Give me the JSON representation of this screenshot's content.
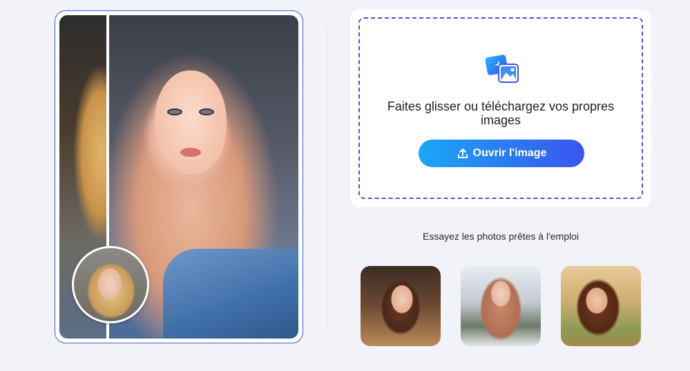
{
  "preview": {
    "description_icon": "before-after-comparison"
  },
  "upload": {
    "icon": "image-add-icon",
    "title": "Faites glisser ou téléchargez vos propres images",
    "button_label": "Ouvrir l'image",
    "button_icon": "upload-icon"
  },
  "samples": {
    "heading": "Essayez les photos prêtes à l'emploi"
  },
  "colors": {
    "accent_start": "#1aa7f4",
    "accent_end": "#3a55ef",
    "border_blue": "#3b5bdb",
    "background": "#f1f3f9"
  }
}
